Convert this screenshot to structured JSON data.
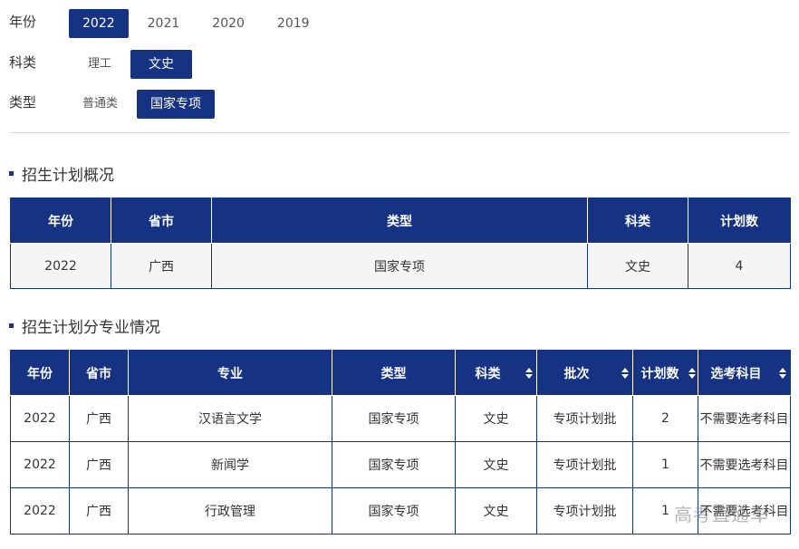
{
  "filters": {
    "year": {
      "label": "年份",
      "options": [
        "2022",
        "2021",
        "2020",
        "2019"
      ],
      "selected": "2022"
    },
    "subject": {
      "label": "科类",
      "options": [
        "理工",
        "文史"
      ],
      "selected": "文史"
    },
    "type": {
      "label": "类型",
      "options": [
        "普通类",
        "国家专项"
      ],
      "selected": "国家专项"
    }
  },
  "overview": {
    "title": "招生计划概况",
    "headers": [
      "年份",
      "省市",
      "类型",
      "科类",
      "计划数"
    ],
    "rows": [
      [
        "2022",
        "广西",
        "国家专项",
        "文史",
        "4"
      ]
    ]
  },
  "majors": {
    "title": "招生计划分专业情况",
    "headers": [
      "年份",
      "省市",
      "专业",
      "类型",
      "科类",
      "批次",
      "计划数",
      "选考科目"
    ],
    "rows": [
      [
        "2022",
        "广西",
        "汉语言文学",
        "国家专项",
        "文史",
        "专项计划批",
        "2",
        "不需要选考科目"
      ],
      [
        "2022",
        "广西",
        "新闻学",
        "国家专项",
        "文史",
        "专项计划批",
        "1",
        "不需要选考科目"
      ],
      [
        "2022",
        "广西",
        "行政管理",
        "国家专项",
        "文史",
        "专项计划批",
        "1",
        "不需要选考科目"
      ]
    ]
  },
  "watermark": "高考直通车",
  "colors": {
    "primary": "#163383"
  }
}
